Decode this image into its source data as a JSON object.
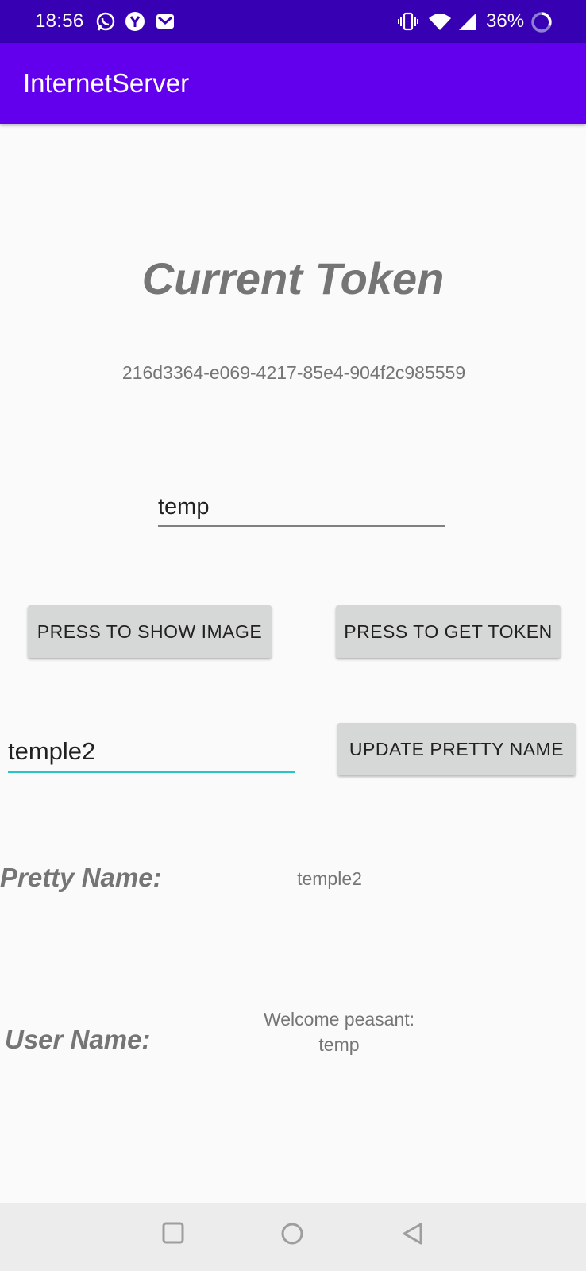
{
  "status_bar": {
    "time": "18:56",
    "battery": "36%",
    "icons": [
      "whatsapp-icon",
      "yahoo-icon",
      "gmail-icon",
      "vibrate-icon",
      "wifi-icon",
      "signal-icon",
      "battery-icon"
    ]
  },
  "app_bar": {
    "title": "InternetServer",
    "color": "#6200ee",
    "status_color": "#3700b3"
  },
  "main": {
    "heading": "Current Token",
    "token": "216d3364-e069-4217-85e4-904f2c985559",
    "name_input_value": "temp",
    "show_image_button": "PRESS TO SHOW IMAGE",
    "get_token_button": "PRESS TO GET TOKEN",
    "pretty_input_value": "temple2",
    "update_pretty_button": "UPDATE PRETTY NAME",
    "pretty_name_label": "Pretty Name:",
    "pretty_name_value": "temple2",
    "user_name_label": "User Name:",
    "user_name_value_line1": "Welcome peasant:",
    "user_name_value_line2": "temp",
    "accent_color": "#26c6c6"
  },
  "nav_bar": {
    "icons": [
      "recents-square-icon",
      "home-circle-icon",
      "back-triangle-icon"
    ]
  }
}
